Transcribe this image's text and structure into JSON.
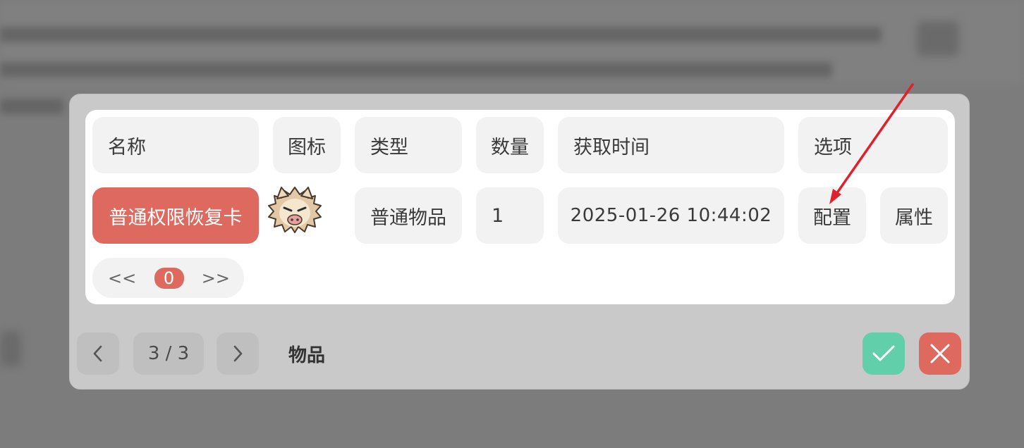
{
  "table": {
    "headers": [
      "名称",
      "图标",
      "类型",
      "数量",
      "获取时间",
      "选项"
    ],
    "row": {
      "name": "普通权限恢复卡",
      "icon": "boar-character-icon",
      "type": "普通物品",
      "quantity": "1",
      "acquired_time": "2025-01-26 10:44:02",
      "options": [
        "配置",
        "属性"
      ]
    },
    "pager": {
      "prev": "<<",
      "current": "0",
      "next": ">>"
    }
  },
  "footer": {
    "page_indicator": "3 / 3",
    "title": "物品",
    "prev_icon": "chevron-left-icon",
    "next_icon": "chevron-right-icon",
    "confirm_icon": "check-icon",
    "cancel_icon": "close-icon"
  },
  "colors": {
    "accent_red": "#de6a5f",
    "confirm_green": "#62cfab",
    "annotation_arrow": "#e0202a"
  }
}
